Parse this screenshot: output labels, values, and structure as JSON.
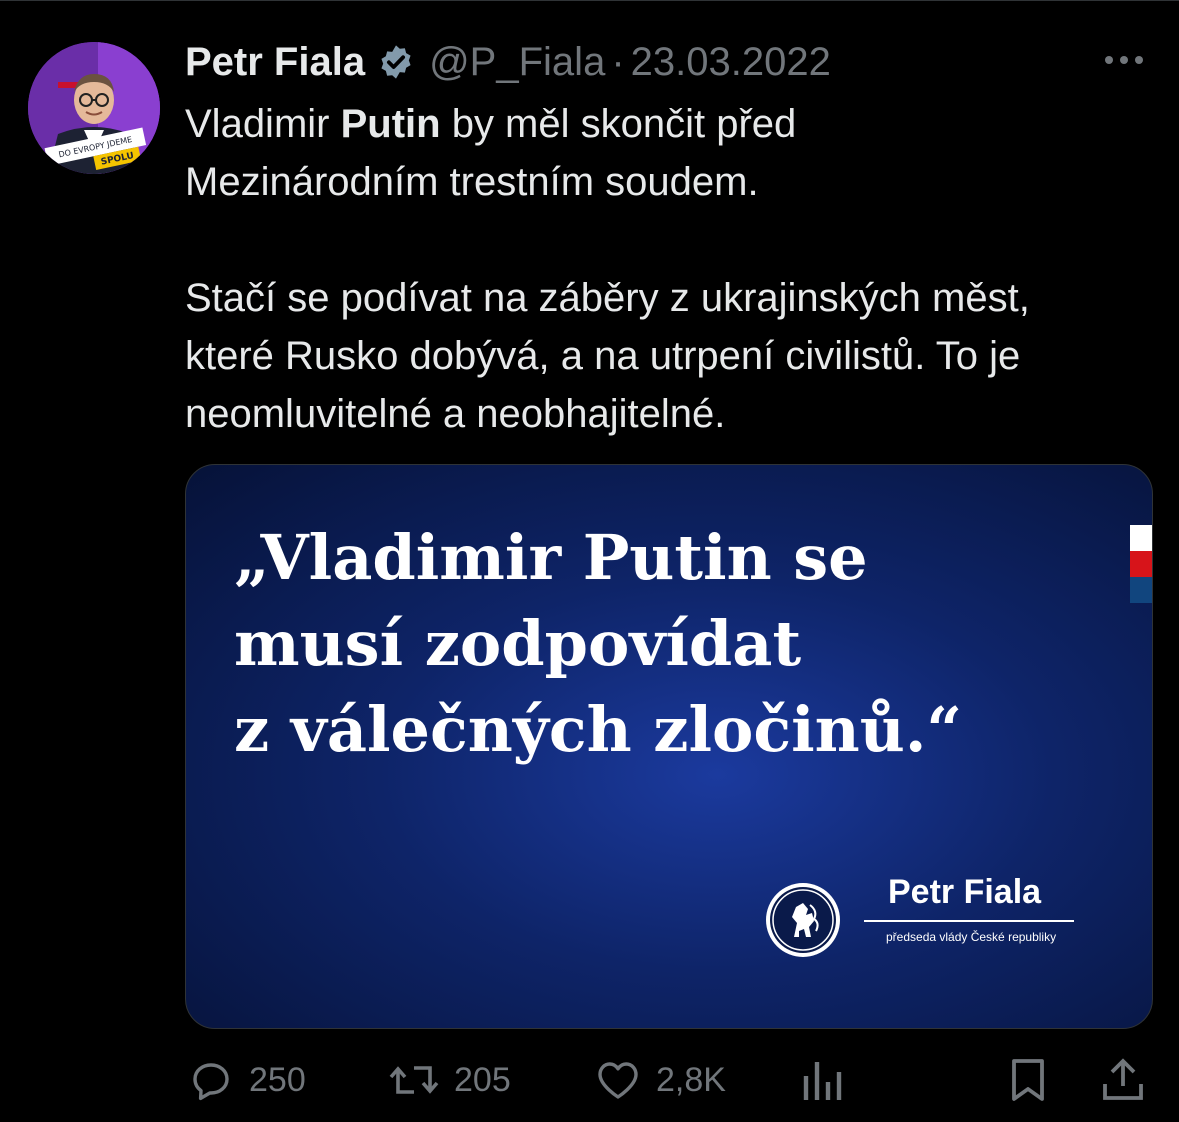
{
  "author": {
    "name": "Petr Fiala",
    "handle": "@P_Fiala",
    "separator": "·",
    "date": "23.03.2022",
    "avatar_badge_top": "DO EVROPY JDEME",
    "avatar_badge_bottom": "SPOLU"
  },
  "body": {
    "line1_pre": "Vladimir ",
    "line1_bold": "Putin",
    "line1_post": " by měl skončit před",
    "line2": "Mezinárodním trestním soudem.",
    "para2_line1": "Stačí se podívat na záběry z ukrajinských měst,",
    "para2_line2": "které Rusko dobývá, a na utrpení civilistů. To je",
    "para2_line3": "neomluvitelné a neobhajitelné."
  },
  "media": {
    "quote_line1": "„Vladimir Putin se",
    "quote_line2": "musí zodpovídat",
    "quote_line3": "z válečných zločinů.“",
    "signature_name": "Petr Fiala",
    "signature_title": "předseda vlády České republiky"
  },
  "actions": {
    "replies": "250",
    "reposts": "205",
    "likes": "2,8K"
  },
  "colors": {
    "background": "#000000",
    "text": "#e7e9ea",
    "secondary": "#71767b",
    "verified": "#829aab",
    "flag_white": "#ffffff",
    "flag_red": "#d7141a",
    "flag_blue": "#11457e"
  }
}
